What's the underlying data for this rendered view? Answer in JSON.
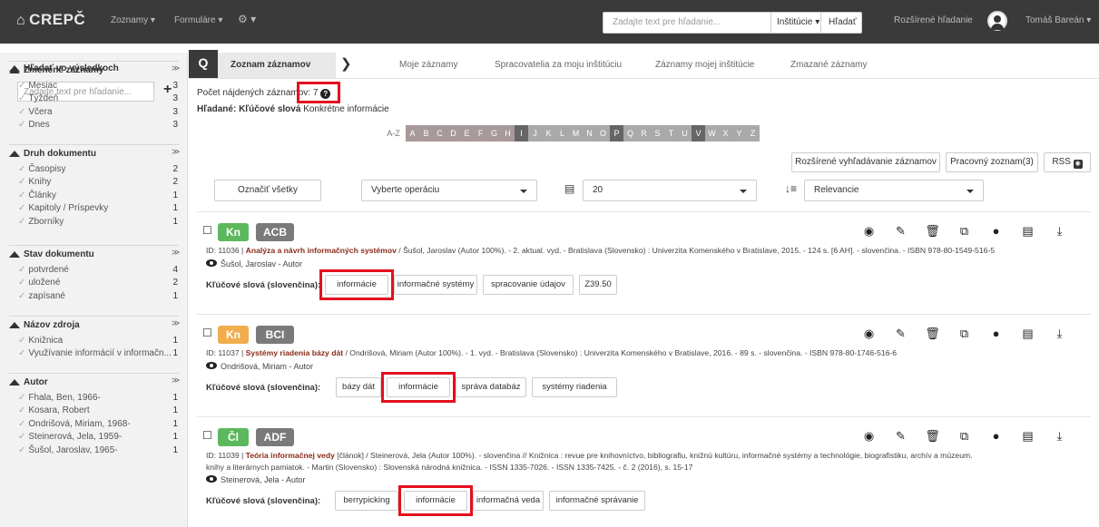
{
  "topbar": {
    "brand": "CREPČ",
    "nav": [
      "Zoznamy ▾",
      "Formuláre ▾",
      "⚙ ▾"
    ],
    "search_placeholder": "Zadajte text pre hľadanie...",
    "inst_label": "Inštitúcie ▾",
    "search_button": "Hľadať",
    "advanced": "Rozšírené hľadanie",
    "user": "Tomáš Bareán ▾"
  },
  "sidebar": {
    "title": "Hľadať vo výsledkoch",
    "search_placeholder": "Zadajte text pre hľadanie...",
    "sections": [
      {
        "title": "Zmenené záznamy",
        "items": [
          [
            "Mesiac",
            "3"
          ],
          [
            "Týždeň",
            "3"
          ],
          [
            "Včera",
            "3"
          ],
          [
            "Dnes",
            "3"
          ]
        ]
      },
      {
        "title": "Druh dokumentu",
        "items": [
          [
            "Časopisy",
            "2"
          ],
          [
            "Knihy",
            "2"
          ],
          [
            "Články",
            "1"
          ],
          [
            "Kapitoly / Príspevky",
            "1"
          ],
          [
            "Zborníky",
            "1"
          ]
        ]
      },
      {
        "title": "Stav dokumentu",
        "items": [
          [
            "potvrdené",
            "4"
          ],
          [
            "uložené",
            "2"
          ],
          [
            "zapísané",
            "1"
          ]
        ]
      },
      {
        "title": "Názov zdroja",
        "items": [
          [
            "Knižnica",
            "1"
          ],
          [
            "Využívanie informácií v informačn...",
            "1"
          ]
        ]
      },
      {
        "title": "Autor",
        "items": [
          [
            "Fhala, Ben, 1966-",
            "1"
          ],
          [
            "Kosara, Robert",
            "1"
          ],
          [
            "Ondrišová, Miriam, 1968-",
            "1"
          ],
          [
            "Steinerová, Jela, 1959-",
            "1"
          ],
          [
            "Šušol, Jaroslav, 1965-",
            "1"
          ]
        ]
      }
    ]
  },
  "tabs": {
    "active": "Zoznam záznamov",
    "others": [
      "Moje záznamy",
      "Spracovatelia za moju inštitúciu",
      "Záznamy mojej inštitúcie",
      "Zmazané záznamy"
    ]
  },
  "results": {
    "count_label": "Počet nájdených záznamov: 7",
    "searched_prefix": "Hľadané: Kľúčové slová",
    "searched_value": "Konkrétne informácie",
    "alphabet": [
      "A-Z",
      "A",
      "B",
      "C",
      "D",
      "E",
      "F",
      "G",
      "H",
      "I",
      "J",
      "K",
      "L",
      "M",
      "N",
      "O",
      "P",
      "Q",
      "R",
      "S",
      "T",
      "U",
      "V",
      "W",
      "X",
      "Y",
      "Z"
    ],
    "adv_button": "Rozšírené vyhľadávanie záznamov",
    "worklist_button": "Pracovný zoznam(3)",
    "rss_button": "RSS",
    "mark_all": "Označiť všetky",
    "operation_select": "Vyberte operáciu",
    "page_size": "20",
    "sort": "Relevancie",
    "keywords_label": "Kľúčové slová (slovenčina):"
  },
  "records": [
    {
      "type": "Kn",
      "type_color": "#5cb85c",
      "category": "ACB",
      "id": "ID: 11036 |",
      "title": "Analýza a návrh informačných systémov",
      "rest": "/ Šušol, Jaroslav (Autor 100%). - 2. aktual. vyd. - Bratislava (Slovensko) : Univerzita Komenského v Bratislave, 2015. - 124 s. [6 AH]. - slovenčina. - ISBN 978-80-1549-516-5",
      "rest2": "",
      "author": "Šušol, Jaroslav - Autor",
      "keywords": [
        "informácie",
        "informačné systémy",
        "spracovanie údajov",
        "Z39.50"
      ]
    },
    {
      "type": "Kn",
      "type_color": "#f0ad4e",
      "category": "BCI",
      "id": "ID: 11037 |",
      "title": "Systémy riadenia bázy dát",
      "rest": "/ Ondrišová, Miriam (Autor 100%). - 1. vyd. - Bratislava (Slovensko) : Univerzita Komenského v Bratislave, 2016. - 89 s. - slovenčina. - ISBN 978-80-1746-516-6",
      "rest2": "",
      "author": "Ondrišová, Miriam - Autor",
      "keywords": [
        "bázy dát",
        "informácie",
        "správa databáz",
        "systémy riadenia"
      ]
    },
    {
      "type": "Čl",
      "type_color": "#5cb85c",
      "category": "ADF",
      "id": "ID: 11039 |",
      "title": "Teória informačnej vedy",
      "rest": "[článok] / Steinerová, Jela (Autor 100%). - slovenčina // Knižnica : revue pre knihovníctvo, bibliografiu, knižnú kultúru, informačné systémy a technológie, biografistiku, archív a múzeum.",
      "rest2": "knihy a literárnych pamiatok. - Martin (Slovensko) : Slovenská národná knižnica. - ISSN 1335-7026. - ISSN 1335-7425. - č. 2 (2016), s. 15-17",
      "author": "Steinerová, Jela - Autor",
      "keywords": [
        "berrypicking",
        "informácie",
        "informačná veda",
        "informačné správanie"
      ]
    }
  ]
}
